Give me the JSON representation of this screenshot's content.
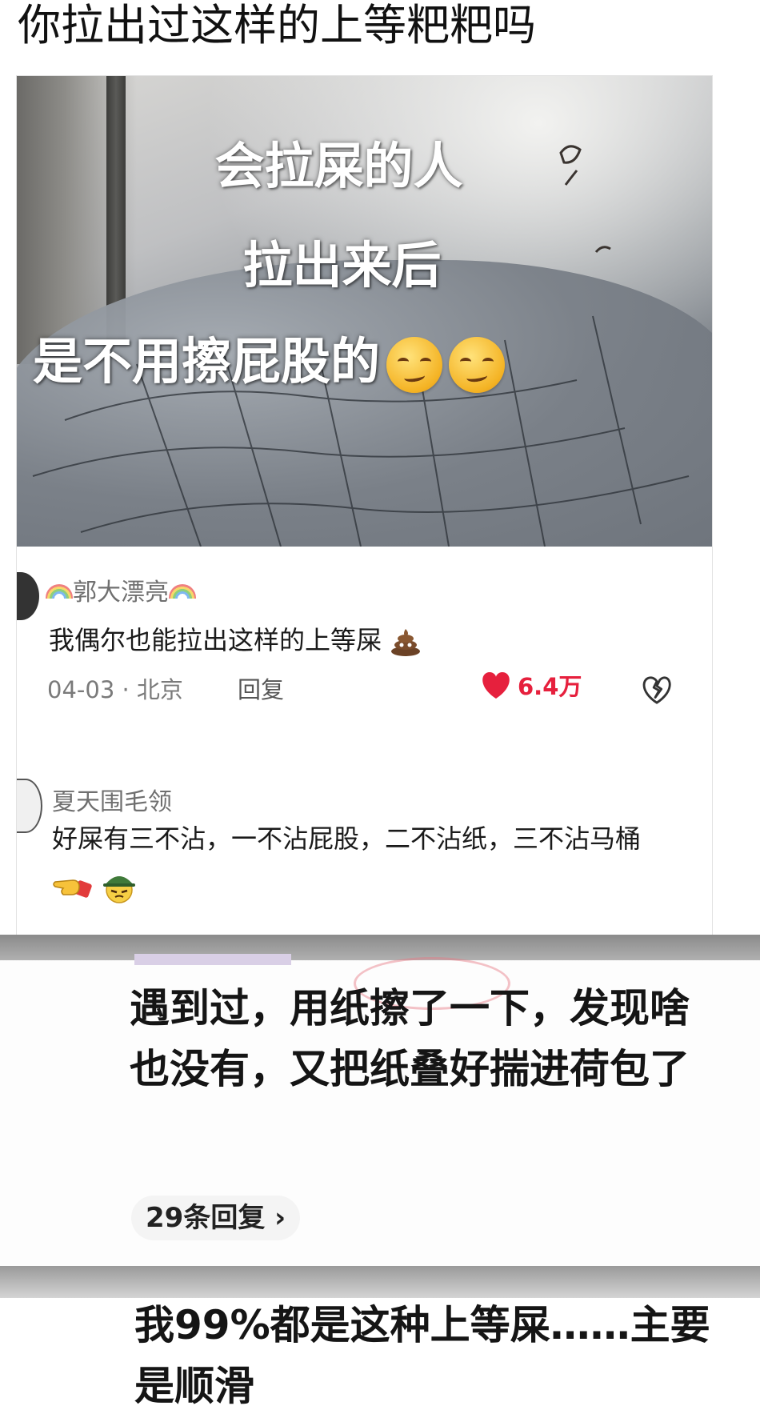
{
  "page_title": "你拉出过这样的上等粑粑吗",
  "video": {
    "caption_line1": "会拉屎的人",
    "caption_line2": "拉出来后",
    "caption_line3": "是不用擦屁股的",
    "caption_emojis": [
      "woozy-face",
      "woozy-face"
    ]
  },
  "comments": [
    {
      "username": "郭大漂亮",
      "text": "我偶尔也能拉出这样的上等屎",
      "text_emoji": "poop",
      "date_location": "04-03 · 北京",
      "reply_label": "回复",
      "like_count": "6.4万"
    },
    {
      "username": "夏天围毛领",
      "text": "好屎有三不沾，一不沾屁股，二不沾纸，三不沾马桶",
      "text_emojis": [
        "pointing-hand",
        "soldier-face"
      ]
    }
  ],
  "reply_screenshot_1": {
    "text": "遇到过，用纸擦了一下，发现啥也没有，又把纸叠好揣进荷包了",
    "replies_link": "29条回复 ›"
  },
  "reply_screenshot_2": {
    "text": "我99%都是这种上等屎……主要是顺滑"
  },
  "colors": {
    "like_red": "#e6203d",
    "meta_gray": "#7a7a7a"
  }
}
